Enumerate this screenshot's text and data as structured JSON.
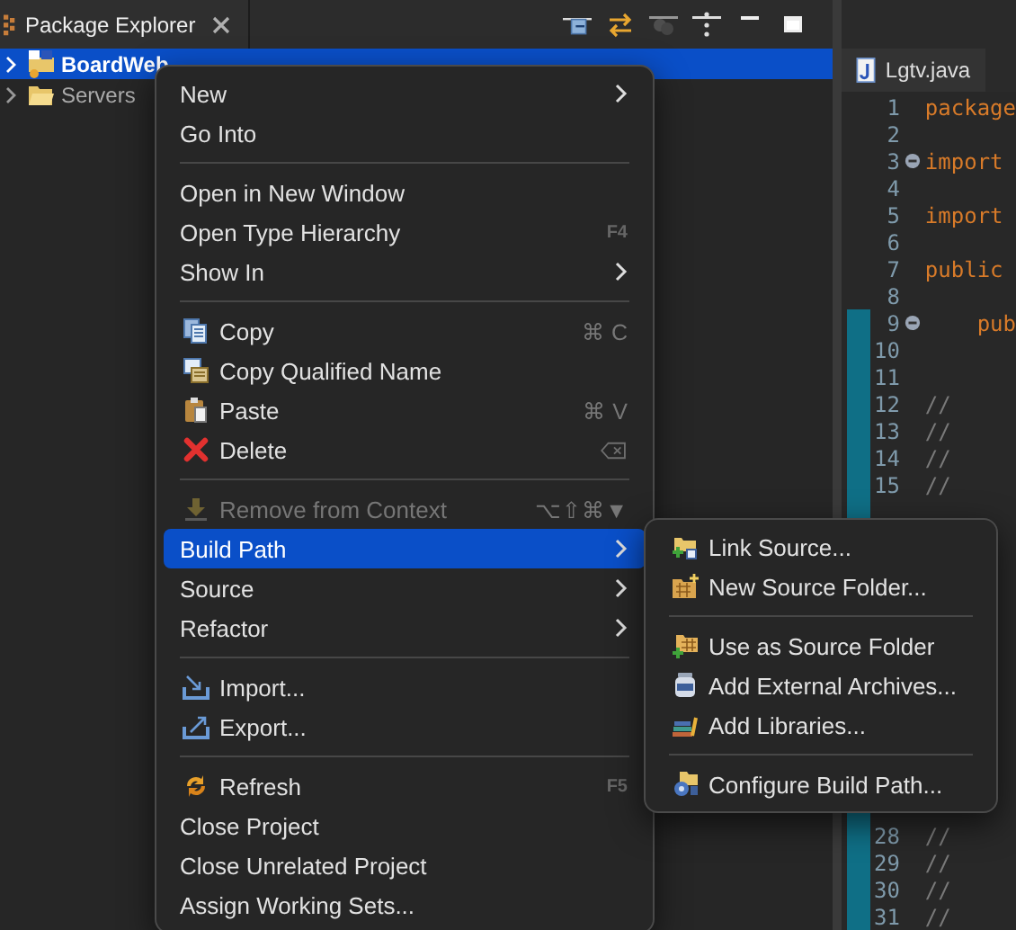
{
  "explorer": {
    "title": "Package Explorer",
    "tree": [
      {
        "label": "BoardWeb",
        "selected": true
      },
      {
        "label": "Servers",
        "selected": false
      }
    ]
  },
  "editor": {
    "tab": "Lgtv.java",
    "lines_top": [
      {
        "number": "1",
        "text": "package",
        "fold": false,
        "changed": false
      },
      {
        "number": "2",
        "fold": false,
        "changed": false
      },
      {
        "number": "3",
        "text": "import",
        "fold": true,
        "changed": false
      },
      {
        "number": "4",
        "fold": false,
        "changed": false
      },
      {
        "number": "5",
        "text": "import",
        "fold": false,
        "changed": false
      },
      {
        "number": "6",
        "fold": false,
        "changed": false
      },
      {
        "number": "7",
        "text": "public",
        "fold": false,
        "changed": false
      },
      {
        "number": "8",
        "fold": false,
        "changed": false
      },
      {
        "number": "9",
        "text": "    pub",
        "fold": true,
        "changed": true
      },
      {
        "number": "10",
        "fold": false,
        "changed": true
      },
      {
        "number": "11",
        "fold": false,
        "changed": true
      },
      {
        "number": "12",
        "text": "//",
        "fold": false,
        "changed": true
      },
      {
        "number": "13",
        "text": "//",
        "fold": false,
        "changed": true
      },
      {
        "number": "14",
        "text": "//",
        "fold": false,
        "changed": true
      },
      {
        "number": "15",
        "text": "//",
        "fold": false,
        "changed": true
      }
    ],
    "lines_bottom": [
      {
        "number": "28",
        "text": "//",
        "fold": false,
        "changed": true
      },
      {
        "number": "29",
        "text": "//",
        "fold": false,
        "changed": true
      },
      {
        "number": "30",
        "text": "//",
        "fold": false,
        "changed": true
      },
      {
        "number": "31",
        "text": "//",
        "fold": false,
        "changed": true
      }
    ]
  },
  "context_menu": [
    {
      "kind": "item",
      "label": "New",
      "submenu": true,
      "selected": false,
      "disabled": false
    },
    {
      "kind": "item",
      "label": "Go Into",
      "submenu": false,
      "selected": false,
      "disabled": false
    },
    {
      "kind": "separator"
    },
    {
      "kind": "item",
      "label": "Open in New Window",
      "submenu": false,
      "selected": false,
      "disabled": false
    },
    {
      "kind": "item",
      "label": "Open Type Hierarchy",
      "shortcut": "F4",
      "submenu": false,
      "selected": false,
      "disabled": false
    },
    {
      "kind": "item",
      "label": "Show In",
      "submenu": true,
      "selected": false,
      "disabled": false
    },
    {
      "kind": "separator"
    },
    {
      "kind": "item",
      "label": "Copy",
      "shortcut": "⌘ C",
      "submenu": false,
      "selected": false,
      "disabled": false
    },
    {
      "kind": "item",
      "label": "Copy Qualified Name",
      "submenu": false,
      "selected": false,
      "disabled": false
    },
    {
      "kind": "item",
      "label": "Paste",
      "shortcut": "⌘ V",
      "submenu": false,
      "selected": false,
      "disabled": false
    },
    {
      "kind": "item",
      "label": "Delete",
      "submenu": false,
      "selected": false,
      "disabled": false
    },
    {
      "kind": "separator"
    },
    {
      "kind": "item",
      "label": "Remove from Context",
      "shortcut": "⌥⇧⌘▼",
      "submenu": false,
      "selected": false,
      "disabled": true
    },
    {
      "kind": "item",
      "label": "Build Path",
      "submenu": true,
      "selected": true,
      "disabled": false
    },
    {
      "kind": "item",
      "label": "Source",
      "submenu": true,
      "selected": false,
      "disabled": false
    },
    {
      "kind": "item",
      "label": "Refactor",
      "submenu": true,
      "selected": false,
      "disabled": false
    },
    {
      "kind": "separator"
    },
    {
      "kind": "item",
      "label": "Import...",
      "submenu": false,
      "selected": false,
      "disabled": false
    },
    {
      "kind": "item",
      "label": "Export...",
      "submenu": false,
      "selected": false,
      "disabled": false
    },
    {
      "kind": "separator"
    },
    {
      "kind": "item",
      "label": "Refresh",
      "shortcut": "F5",
      "submenu": false,
      "selected": false,
      "disabled": false
    },
    {
      "kind": "item",
      "label": "Close Project",
      "submenu": false,
      "selected": false,
      "disabled": false
    },
    {
      "kind": "item",
      "label": "Close Unrelated Project",
      "submenu": false,
      "selected": false,
      "disabled": false
    },
    {
      "kind": "item",
      "label": "Assign Working Sets...",
      "submenu": false,
      "selected": false,
      "disabled": false
    }
  ],
  "build_path_menu": [
    {
      "kind": "item",
      "label": "Link Source...",
      "selected": false
    },
    {
      "kind": "item",
      "label": "New Source Folder...",
      "selected": false
    },
    {
      "kind": "separator"
    },
    {
      "kind": "item",
      "label": "Use as Source Folder",
      "selected": false
    },
    {
      "kind": "item",
      "label": "Add External Archives...",
      "selected": false
    },
    {
      "kind": "item",
      "label": "Add Libraries...",
      "selected": false
    },
    {
      "kind": "separator"
    },
    {
      "kind": "item",
      "label": "Configure Build Path...",
      "selected": false
    }
  ]
}
